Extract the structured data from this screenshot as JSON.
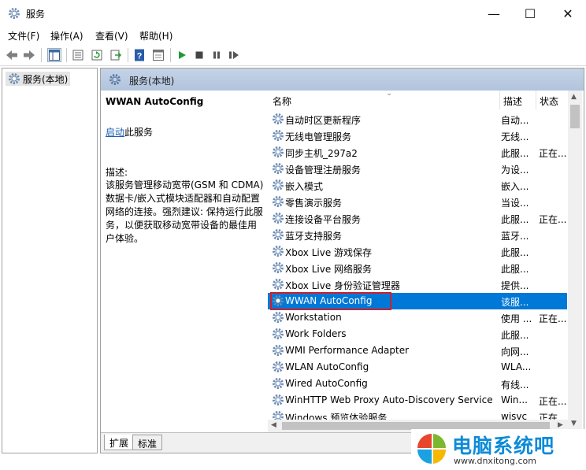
{
  "window": {
    "title": "服务",
    "minimize_glyph": "—",
    "maximize_glyph": "☐",
    "close_glyph": "✕"
  },
  "menu": {
    "items": [
      "文件(F)",
      "操作(A)",
      "查看(V)",
      "帮助(H)"
    ]
  },
  "toolbar": {
    "icons": [
      "back-icon",
      "forward-icon",
      "show-tree-icon",
      "properties-icon",
      "refresh-icon",
      "export-icon",
      "help-icon",
      "console-icon",
      "start-service-icon",
      "stop-service-icon",
      "pause-service-icon",
      "restart-service-icon"
    ]
  },
  "tree": {
    "root_label": "服务(本地)"
  },
  "pane": {
    "header": "服务(本地)"
  },
  "detail": {
    "service_name": "WWAN AutoConfig",
    "start_link": "启动",
    "start_suffix": "此服务",
    "desc_label": "描述:",
    "desc_text": "该服务管理移动宽带(GSM 和 CDMA)\n数据卡/嵌入式模块适配器和自动配置\n网络的连接。强烈建议: 保持运行此服\n务，以便获取移动宽带设备的最佳用\n户体验。"
  },
  "list": {
    "columns": {
      "name": "名称",
      "desc": "描述",
      "state": "状态"
    },
    "rows": [
      {
        "name": "自动时区更新程序",
        "desc": "自动...",
        "state": ""
      },
      {
        "name": "无线电管理服务",
        "desc": "无线...",
        "state": ""
      },
      {
        "name": "同步主机_297a2",
        "desc": "此服...",
        "state": "正在..."
      },
      {
        "name": "设备管理注册服务",
        "desc": "为设...",
        "state": ""
      },
      {
        "name": "嵌入模式",
        "desc": "嵌入...",
        "state": ""
      },
      {
        "name": "零售演示服务",
        "desc": "当设...",
        "state": ""
      },
      {
        "name": "连接设备平台服务",
        "desc": "此服...",
        "state": "正在..."
      },
      {
        "name": "蓝牙支持服务",
        "desc": "蓝牙...",
        "state": ""
      },
      {
        "name": "Xbox Live 游戏保存",
        "desc": "此服...",
        "state": ""
      },
      {
        "name": "Xbox Live 网络服务",
        "desc": "此服...",
        "state": ""
      },
      {
        "name": "Xbox Live 身份验证管理器",
        "desc": "提供...",
        "state": ""
      },
      {
        "name": "WWAN AutoConfig",
        "desc": "该服...",
        "state": "",
        "selected": true
      },
      {
        "name": "Workstation",
        "desc": "使用 ...",
        "state": "正在..."
      },
      {
        "name": "Work Folders",
        "desc": "此服...",
        "state": ""
      },
      {
        "name": "WMI Performance Adapter",
        "desc": "向网...",
        "state": ""
      },
      {
        "name": "WLAN AutoConfig",
        "desc": "WLA...",
        "state": ""
      },
      {
        "name": "Wired AutoConfig",
        "desc": "有线...",
        "state": ""
      },
      {
        "name": "WinHTTP Web Proxy Auto-Discovery Service",
        "desc": "Win...",
        "state": "正在..."
      },
      {
        "name": "Windows 预览体验服务",
        "desc": "wisvc",
        "state": "正在..."
      }
    ]
  },
  "tabs": [
    "扩展",
    "标准"
  ],
  "watermark": {
    "title": "电脑系统吧",
    "url": "www.dnxitong.com"
  },
  "colors": {
    "selection": "#0078d7",
    "highlight_box": "#d0202a",
    "pane_header": "#b8c9df",
    "link": "#1a5fb4"
  }
}
